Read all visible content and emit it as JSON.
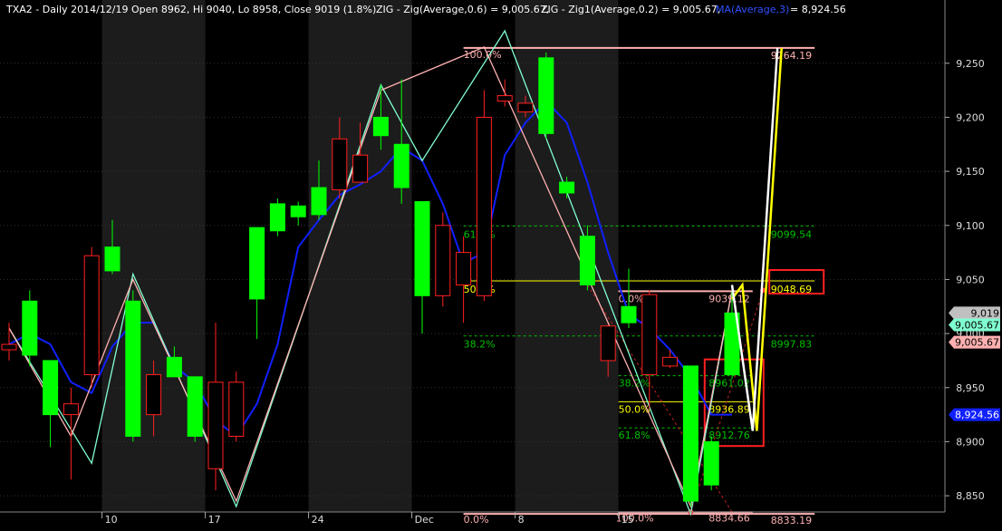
{
  "header": {
    "symbol": "TXA2",
    "text": "TXA2 - Daily 2014/12/19 Open 8962, Hi 9040, Lo 8958, Close 9019 (1.8%)",
    "zig1_text": "ZIG - Zig(Average,0.6) = 9,005.67,",
    "zig2_text": "ZIG - Zig1(Average,0.2) = 9,005.67,",
    "ma_text": "MA(Average,3)",
    "ma_value": "= 8,924.56"
  },
  "colors": {
    "background": "#000000",
    "alt_band": "#1c1c1c",
    "up_candle": "#00ff00",
    "down_candle": "#000000",
    "down_outline": "#ff2020",
    "zig1": "#ffb0b0",
    "zig2": "#80ffd0",
    "ma": "#1020ff",
    "fib_line": "#00c000",
    "fib_50": "#ffff00",
    "highlight_box": "#ff2020"
  },
  "chart_data": {
    "type": "candlestick",
    "ylim": [
      8835,
      9285
    ],
    "y_ticks": [
      "9,250",
      "9,200",
      "9,150",
      "9,100",
      "9,050",
      "9,000",
      "8,950",
      "8,900",
      "8,850"
    ],
    "y_tick_values": [
      9250,
      9200,
      9150,
      9100,
      9050,
      9000,
      8950,
      8900,
      8850
    ],
    "x_ticks": [
      "10",
      "17",
      "24",
      "Dec",
      "8",
      "15"
    ],
    "x_tick_index": [
      5,
      10,
      15,
      20,
      25,
      30
    ],
    "candles": [
      {
        "o": 8990,
        "h": 9010,
        "l": 8975,
        "c": 8985
      },
      {
        "o": 8980,
        "h": 9040,
        "l": 8970,
        "c": 9030
      },
      {
        "o": 8925,
        "h": 8975,
        "l": 8895,
        "c": 8975
      },
      {
        "o": 8935,
        "h": 8950,
        "l": 8865,
        "c": 8925
      },
      {
        "o": 9072,
        "h": 9080,
        "l": 8950,
        "c": 8962
      },
      {
        "o": 9058,
        "h": 9105,
        "l": 9055,
        "c": 9080
      },
      {
        "o": 8905,
        "h": 9040,
        "l": 8900,
        "c": 9030
      },
      {
        "o": 8962,
        "h": 8975,
        "l": 8905,
        "c": 8925
      },
      {
        "o": 8960,
        "h": 8988,
        "l": 8960,
        "c": 8978
      },
      {
        "o": 8905,
        "h": 8960,
        "l": 8900,
        "c": 8960
      },
      {
        "o": 8955,
        "h": 9010,
        "l": 8855,
        "c": 8875
      },
      {
        "o": 8955,
        "h": 8965,
        "l": 8900,
        "c": 8905
      },
      {
        "o": 9032,
        "h": 9045,
        "l": 8995,
        "c": 9098
      },
      {
        "o": 9095,
        "h": 9125,
        "l": 9090,
        "c": 9120
      },
      {
        "o": 9108,
        "h": 9122,
        "l": 9100,
        "c": 9118
      },
      {
        "o": 9110,
        "h": 9160,
        "l": 9105,
        "c": 9135
      },
      {
        "o": 9180,
        "h": 9200,
        "l": 9125,
        "c": 9133
      },
      {
        "o": 9165,
        "h": 9195,
        "l": 9150,
        "c": 9140
      },
      {
        "o": 9183,
        "h": 9230,
        "l": 9170,
        "c": 9200
      },
      {
        "o": 9135,
        "h": 9235,
        "l": 9120,
        "c": 9175
      },
      {
        "o": 9035,
        "h": 9100,
        "l": 9000,
        "c": 9122
      },
      {
        "o": 9100,
        "h": 9112,
        "l": 9025,
        "c": 9035
      },
      {
        "o": 9075,
        "h": 9090,
        "l": 9010,
        "c": 9045
      },
      {
        "o": 9200,
        "h": 9225,
        "l": 9030,
        "c": 9035
      },
      {
        "o": 9220,
        "h": 9235,
        "l": 9210,
        "c": 9215
      },
      {
        "o": 9213,
        "h": 9220,
        "l": 9200,
        "c": 9205
      },
      {
        "o": 9185,
        "h": 9260,
        "l": 9180,
        "c": 9255
      },
      {
        "o": 9130,
        "h": 9145,
        "l": 9125,
        "c": 9140
      },
      {
        "o": 9045,
        "h": 9100,
        "l": 9040,
        "c": 9090
      },
      {
        "o": 9007,
        "h": 9008,
        "l": 8960,
        "c": 8975
      },
      {
        "o": 9010,
        "h": 9060,
        "l": 9005,
        "c": 9025
      },
      {
        "o": 9036,
        "h": 9040,
        "l": 8930,
        "c": 8962
      },
      {
        "o": 8978,
        "h": 8985,
        "l": 8968,
        "c": 8970
      },
      {
        "o": 8845,
        "h": 8970,
        "l": 8840,
        "c": 8970
      },
      {
        "o": 8860,
        "h": 8905,
        "l": 8855,
        "c": 8900
      },
      {
        "o": 8962,
        "h": 9040,
        "l": 8958,
        "c": 9019
      }
    ],
    "zigzag1": [
      [
        0,
        9005
      ],
      [
        3,
        8905
      ],
      [
        6,
        9050
      ],
      [
        11,
        8845
      ],
      [
        18,
        9225
      ],
      [
        23,
        9265
      ],
      [
        33,
        8840
      ],
      [
        35,
        9040
      ]
    ],
    "zigzag2": [
      [
        0,
        9005
      ],
      [
        4,
        8880
      ],
      [
        6,
        9055
      ],
      [
        11,
        8840
      ],
      [
        18,
        9230
      ],
      [
        20,
        9160
      ],
      [
        24,
        9280
      ],
      [
        33,
        8833
      ],
      [
        35,
        9040
      ]
    ],
    "ma": [
      [
        0,
        8990
      ],
      [
        1,
        9000
      ],
      [
        2,
        8990
      ],
      [
        3,
        8955
      ],
      [
        4,
        8945
      ],
      [
        5,
        8988
      ],
      [
        6,
        9010
      ],
      [
        7,
        9010
      ],
      [
        8,
        8970
      ],
      [
        9,
        8955
      ],
      [
        10,
        8920
      ],
      [
        11,
        8905
      ],
      [
        12,
        8935
      ],
      [
        13,
        8990
      ],
      [
        14,
        9080
      ],
      [
        15,
        9105
      ],
      [
        16,
        9128
      ],
      [
        17,
        9138
      ],
      [
        18,
        9150
      ],
      [
        19,
        9172
      ],
      [
        20,
        9160
      ],
      [
        21,
        9120
      ],
      [
        22,
        9065
      ],
      [
        23,
        9075
      ],
      [
        24,
        9165
      ],
      [
        25,
        9195
      ],
      [
        26,
        9215
      ],
      [
        27,
        9195
      ],
      [
        28,
        9140
      ],
      [
        29,
        9075
      ],
      [
        30,
        9018
      ],
      [
        31,
        9005
      ],
      [
        32,
        8985
      ],
      [
        33,
        8960
      ],
      [
        34,
        8925
      ],
      [
        35,
        8925
      ]
    ],
    "fib_retracement_1": {
      "x_start": 22,
      "x_end": 39,
      "anchor_low": 8833.19,
      "anchor_high": 9264.19,
      "anchor_low_label": "0.0%",
      "anchor_high_label": "100.0%",
      "levels": [
        {
          "label": "61.8%",
          "price": 9099.54,
          "price_label": "9099.54",
          "color": "#00c000"
        },
        {
          "label": "50.0%",
          "price": 9048.69,
          "price_label": "9048.69",
          "color": "#ffff00"
        },
        {
          "label": "38.2%",
          "price": 8997.83,
          "price_label": "8997.83",
          "color": "#00c000"
        }
      ],
      "low_price_label": "8833.19",
      "high_price_label": "9264.19"
    },
    "fib_retracement_2": {
      "x_start": 29.5,
      "x_end": 36,
      "anchor_high": 9039.12,
      "anchor_low": 8834.66,
      "anchor_high_label": "0.0%",
      "anchor_low_label": "100.0%",
      "levels": [
        {
          "label": "38.2%",
          "price": 8961.02,
          "price_label": "8961.02",
          "color": "#00c000"
        },
        {
          "label": "50.0%",
          "price": 8936.89,
          "price_label": "8936.89",
          "color": "#ffff00"
        },
        {
          "label": "61.8%",
          "price": 8912.76,
          "price_label": "8912.76",
          "color": "#00c000"
        }
      ],
      "high_price_label": "9039.12",
      "low_price_label": "8834.66"
    },
    "projection_lines": [
      {
        "color": "#ffff00",
        "points": [
          [
            35,
            9032
          ],
          [
            35.5,
            9045
          ],
          [
            36.2,
            8910
          ],
          [
            37.4,
            9264
          ]
        ]
      },
      {
        "color": "#ffffff",
        "points": [
          [
            35,
            9045
          ],
          [
            36,
            8910
          ],
          [
            37.2,
            9264
          ]
        ]
      }
    ],
    "forecast_dashed": [
      [
        [
          28,
          9045
        ],
        [
          35,
          8835
        ]
      ],
      [
        [
          33,
          8835
        ],
        [
          36.5,
          9040
        ]
      ]
    ],
    "last_price_tags": [
      {
        "text": "9,019",
        "price": 9019,
        "bg": "#c0c0c0",
        "fg": "#000000"
      },
      {
        "text": "9,005.67",
        "price": 9008,
        "bg": "#80ffd0",
        "fg": "#000000"
      },
      {
        "text": "9,005.67",
        "price": 8992,
        "bg": "#ffb0b0",
        "fg": "#000000"
      },
      {
        "text": "8,924.56",
        "price": 8925,
        "bg": "#1020ff",
        "fg": "#ffffff"
      }
    ]
  }
}
